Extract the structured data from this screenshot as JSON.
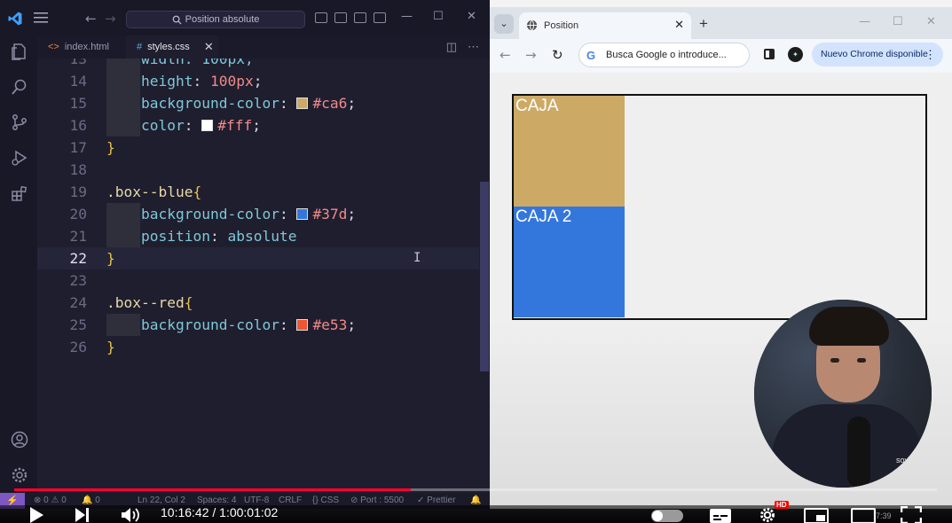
{
  "vscode": {
    "title_search": "Position absolute",
    "tabs": [
      {
        "label": "index.html",
        "active": false
      },
      {
        "label": "styles.css",
        "active": true
      }
    ],
    "current_line": 22,
    "lines": [
      {
        "no": "13",
        "text": "width: 100px;"
      },
      {
        "no": "14",
        "prop": "height",
        "value": "100px",
        "suffix": ";"
      },
      {
        "no": "15",
        "prop": "background-color",
        "value": "#ca6",
        "swatch": "#ccaa66",
        "suffix": ";"
      },
      {
        "no": "16",
        "prop": "color",
        "value": "#fff",
        "swatch": "#ffffff",
        "suffix": ";"
      },
      {
        "no": "17",
        "brace": "}"
      },
      {
        "no": "18"
      },
      {
        "no": "19",
        "selector": ".box--blue",
        "brace": "{"
      },
      {
        "no": "20",
        "prop": "background-color",
        "value": "#37d",
        "swatch": "#3377dd",
        "suffix": ";"
      },
      {
        "no": "21",
        "prop": "position",
        "value": "absolute",
        "suffix": ""
      },
      {
        "no": "22",
        "brace": "}"
      },
      {
        "no": "23"
      },
      {
        "no": "24",
        "selector": ".box--red",
        "brace": "{"
      },
      {
        "no": "25",
        "prop": "background-color",
        "value": "#e53",
        "swatch": "#ee5533",
        "suffix": ";"
      },
      {
        "no": "26",
        "brace": "}"
      }
    ],
    "status": {
      "errors": "0",
      "warnings": "0",
      "info": "0",
      "position": "Ln 22, Col 2",
      "spaces": "Spaces: 4",
      "encoding": "UTF-8",
      "eol": "CRLF",
      "language": "CSS",
      "port": "Port : 5500",
      "formatter": "Prettier"
    }
  },
  "chrome": {
    "tab_title": "Position",
    "omnibox_placeholder": "Busca Google o introduce...",
    "update_button": "Nuevo Chrome disponible"
  },
  "page": {
    "box1_label": "CAJA",
    "box2_label": "CAJA 2",
    "box1_color": "#ccaa66",
    "box2_color": "#3377dd"
  },
  "webcam": {
    "watermark": "soydalto"
  },
  "youtube": {
    "time": "10:16:42 / 1:00:01:02",
    "progress": 0.43,
    "hd_badge": "HD",
    "clock": "7:39"
  },
  "colors": {
    "accent_red": "#ff0033",
    "vscode_bg": "#1f1e2e",
    "remote_purple": "#7e57c2"
  }
}
